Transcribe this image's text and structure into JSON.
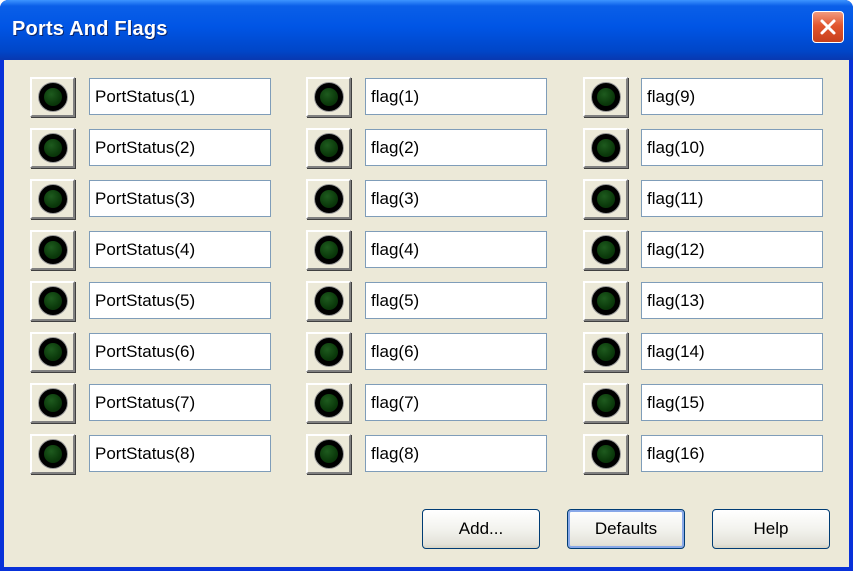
{
  "window": {
    "title": "Ports And Flags",
    "close_icon": "close-icon"
  },
  "colors": {
    "title_bar": "#0055e5",
    "client_bg": "#ece9d8",
    "close_button": "#e2562e",
    "led_off": "#0b3a0b",
    "field_border": "#7f9db9"
  },
  "columns": [
    {
      "items": [
        {
          "label": "PortStatus(1)"
        },
        {
          "label": "PortStatus(2)"
        },
        {
          "label": "PortStatus(3)"
        },
        {
          "label": "PortStatus(4)"
        },
        {
          "label": "PortStatus(5)"
        },
        {
          "label": "PortStatus(6)"
        },
        {
          "label": "PortStatus(7)"
        },
        {
          "label": "PortStatus(8)"
        }
      ]
    },
    {
      "items": [
        {
          "label": "flag(1)"
        },
        {
          "label": "flag(2)"
        },
        {
          "label": "flag(3)"
        },
        {
          "label": "flag(4)"
        },
        {
          "label": "flag(5)"
        },
        {
          "label": "flag(6)"
        },
        {
          "label": "flag(7)"
        },
        {
          "label": "flag(8)"
        }
      ]
    },
    {
      "items": [
        {
          "label": "flag(9)"
        },
        {
          "label": "flag(10)"
        },
        {
          "label": "flag(11)"
        },
        {
          "label": "flag(12)"
        },
        {
          "label": "flag(13)"
        },
        {
          "label": "flag(14)"
        },
        {
          "label": "flag(15)"
        },
        {
          "label": "flag(16)"
        }
      ]
    }
  ],
  "buttons": {
    "add": "Add...",
    "defaults": "Defaults",
    "help": "Help"
  }
}
